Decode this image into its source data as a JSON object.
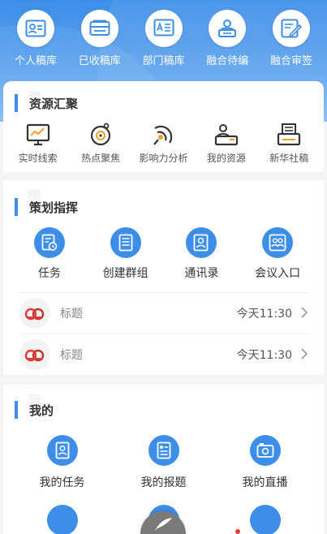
{
  "top_nav": [
    {
      "label": "个人稿库",
      "icon": "id-card-icon"
    },
    {
      "label": "已收稿库",
      "icon": "inbox-tray-icon"
    },
    {
      "label": "部门稿库",
      "icon": "document-a-icon"
    },
    {
      "label": "融合待编",
      "icon": "person-board-icon"
    },
    {
      "label": "融合审签",
      "icon": "sign-document-icon"
    }
  ],
  "resources": {
    "title": "资源汇聚",
    "ghost": "资",
    "items": [
      {
        "label": "实时线索",
        "icon": "monitor-chart-icon"
      },
      {
        "label": "热点聚焦",
        "icon": "target-focus-icon"
      },
      {
        "label": "影响力分析",
        "icon": "signal-broadcast-icon"
      },
      {
        "label": "我的资源",
        "icon": "user-desk-icon"
      },
      {
        "label": "新华社稿",
        "icon": "printer-doc-icon"
      }
    ]
  },
  "planning": {
    "title": "策划指挥",
    "ghost": "策",
    "items": [
      {
        "label": "任务",
        "icon": "task-clock-icon"
      },
      {
        "label": "创建群组",
        "icon": "group-doc-icon"
      },
      {
        "label": "通讯录",
        "icon": "contacts-icon"
      },
      {
        "label": "会议入口",
        "icon": "meeting-icon"
      }
    ],
    "list": [
      {
        "title": "标题",
        "time": "今天11:30"
      },
      {
        "title": "标题",
        "time": "今天11:30"
      }
    ]
  },
  "mine": {
    "title": "我的",
    "ghost": "我",
    "items": [
      {
        "label": "我的任务",
        "icon": "my-task-icon"
      },
      {
        "label": "我的报题",
        "icon": "my-report-icon"
      },
      {
        "label": "我的直播",
        "icon": "live-camera-icon"
      }
    ]
  },
  "colors": {
    "accent": "#3d8ee8",
    "logo_red": "#e33b3b"
  }
}
